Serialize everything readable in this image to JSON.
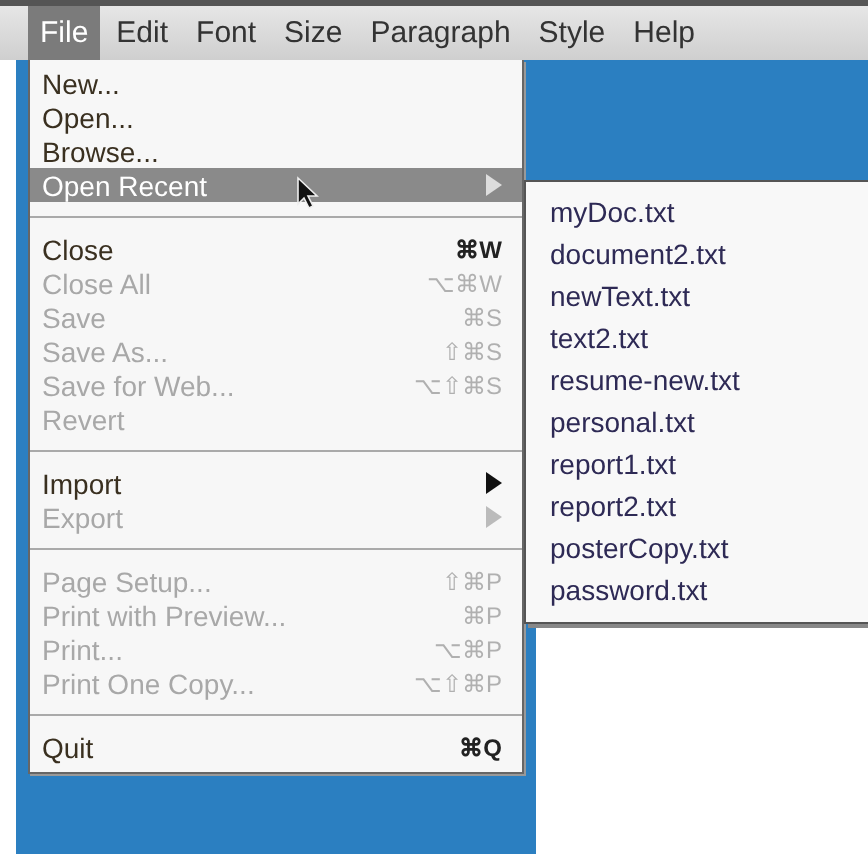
{
  "menu_bar": [
    {
      "label": "File",
      "selected": true
    },
    {
      "label": "Edit",
      "selected": false
    },
    {
      "label": "Font",
      "selected": false
    },
    {
      "label": "Size",
      "selected": false
    },
    {
      "label": "Paragraph",
      "selected": false
    },
    {
      "label": "Style",
      "selected": false
    },
    {
      "label": "Help",
      "selected": false
    }
  ],
  "file_menu": {
    "sections": [
      [
        {
          "label": "New...",
          "disabled": false,
          "selected": false,
          "has_submenu": false
        },
        {
          "label": "Open...",
          "disabled": false,
          "selected": false,
          "has_submenu": false
        },
        {
          "label": "Browse...",
          "disabled": false,
          "selected": false,
          "has_submenu": false
        },
        {
          "label": "Open Recent",
          "disabled": false,
          "selected": true,
          "has_submenu": true
        }
      ],
      [
        {
          "label": "Close",
          "shortcut": "⌘W",
          "disabled": false,
          "selected": false,
          "has_submenu": false
        },
        {
          "label": "Close All",
          "shortcut": "⌥⌘W",
          "disabled": true,
          "selected": false,
          "has_submenu": false
        },
        {
          "label": "Save",
          "shortcut": "⌘S",
          "disabled": true,
          "selected": false,
          "has_submenu": false
        },
        {
          "label": "Save As...",
          "shortcut": "⇧⌘S",
          "disabled": true,
          "selected": false,
          "has_submenu": false
        },
        {
          "label": "Save for Web...",
          "shortcut": "⌥⇧⌘S",
          "disabled": true,
          "selected": false,
          "has_submenu": false
        },
        {
          "label": "Revert",
          "disabled": true,
          "selected": false,
          "has_submenu": false
        }
      ],
      [
        {
          "label": "Import",
          "disabled": false,
          "selected": false,
          "has_submenu": true
        },
        {
          "label": "Export",
          "disabled": true,
          "selected": false,
          "has_submenu": true
        }
      ],
      [
        {
          "label": "Page Setup...",
          "shortcut": "⇧⌘P",
          "disabled": true,
          "selected": false,
          "has_submenu": false
        },
        {
          "label": "Print with Preview...",
          "shortcut": "⌘P",
          "disabled": true,
          "selected": false,
          "has_submenu": false
        },
        {
          "label": "Print...",
          "shortcut": "⌥⌘P",
          "disabled": true,
          "selected": false,
          "has_submenu": false
        },
        {
          "label": "Print One Copy...",
          "shortcut": "⌥⇧⌘P",
          "disabled": true,
          "selected": false,
          "has_submenu": false
        }
      ],
      [
        {
          "label": "Quit",
          "shortcut": "⌘Q",
          "disabled": false,
          "selected": false,
          "has_submenu": false
        }
      ]
    ]
  },
  "recent_files": [
    "myDoc.txt",
    "document2.txt",
    "newText.txt",
    "text2.txt",
    "resume-new.txt",
    "personal.txt",
    "report1.txt",
    "report2.txt",
    "posterCopy.txt",
    "password.txt"
  ]
}
